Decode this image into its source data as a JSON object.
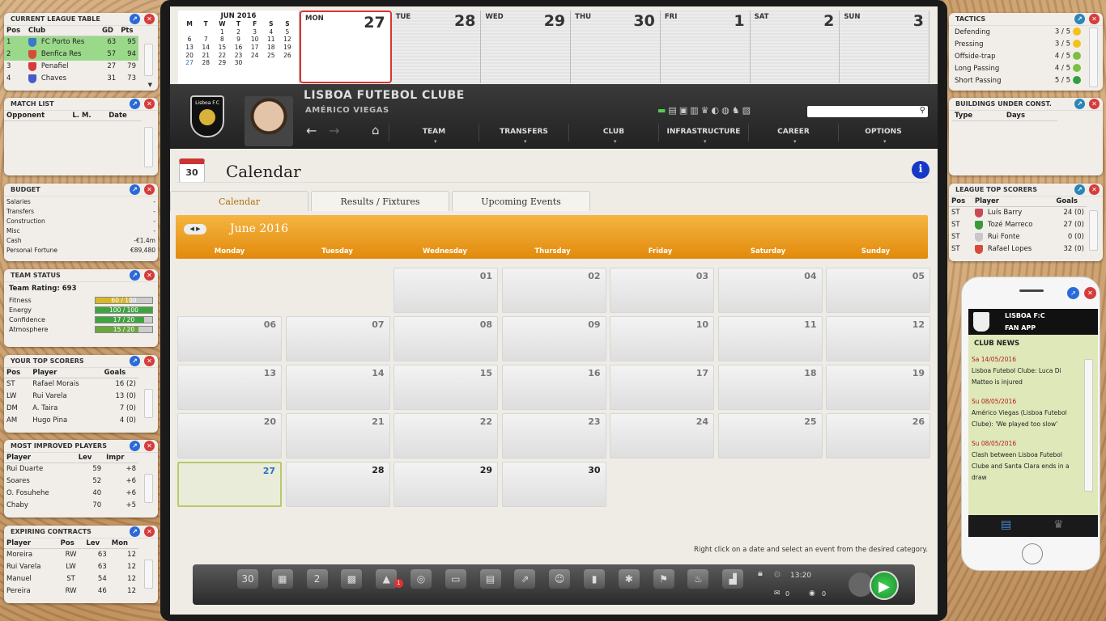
{
  "league_table": {
    "title": "CURRENT LEAGUE TABLE",
    "cols": [
      "Pos",
      "Club",
      "GD",
      "Pts"
    ],
    "rows": [
      [
        "1",
        "FC Porto Res",
        "63",
        "95"
      ],
      [
        "2",
        "Benfica Res",
        "57",
        "94"
      ],
      [
        "3",
        "Penafiel",
        "27",
        "79"
      ],
      [
        "4",
        "Chaves",
        "31",
        "73"
      ]
    ]
  },
  "match_list": {
    "title": "MATCH LIST",
    "cols": [
      "Opponent",
      "L. M.",
      "Date"
    ]
  },
  "budget": {
    "title": "BUDGET",
    "rows": [
      [
        "Salaries",
        "-"
      ],
      [
        "Transfers",
        "-"
      ],
      [
        "Construction",
        "-"
      ],
      [
        "Misc",
        "-"
      ],
      [
        "Cash",
        "-€1.4m"
      ],
      [
        "Personal Fortune",
        "€89,480"
      ]
    ]
  },
  "team_status": {
    "title": "TEAM STATUS",
    "rating": "Team Rating: 693",
    "rows": [
      {
        "label": "Fitness",
        "value": "60 / 100",
        "pct": 60,
        "color": "#d8b628"
      },
      {
        "label": "Energy",
        "value": "100 / 100",
        "pct": 100,
        "color": "#3ea53e"
      },
      {
        "label": "Confidence",
        "value": "17 / 20",
        "pct": 85,
        "color": "#3ea53e"
      },
      {
        "label": "Atmosphere",
        "value": "15 / 20",
        "pct": 75,
        "color": "#6aa83e"
      }
    ]
  },
  "your_scorers": {
    "title": "YOUR TOP SCORERS",
    "cols": [
      "Pos",
      "Player",
      "Goals"
    ],
    "rows": [
      [
        "ST",
        "Rafael Morais",
        "16 (2)"
      ],
      [
        "LW",
        "Rui Varela",
        "13 (0)"
      ],
      [
        "DM",
        "A. Taira",
        "7 (0)"
      ],
      [
        "AM",
        "Hugo Pina",
        "4 (0)"
      ]
    ]
  },
  "improved": {
    "title": "MOST IMPROVED PLAYERS",
    "cols": [
      "Player",
      "Lev",
      "Impr"
    ],
    "rows": [
      [
        "Rui Duarte",
        "59",
        "+8"
      ],
      [
        "Soares",
        "52",
        "+6"
      ],
      [
        "O. Fosuhehe",
        "40",
        "+6"
      ],
      [
        "Chaby",
        "70",
        "+5"
      ]
    ]
  },
  "contracts": {
    "title": "EXPIRING CONTRACTS",
    "cols": [
      "Player",
      "Pos",
      "Lev",
      "Mon"
    ],
    "rows": [
      [
        "Moreira",
        "RW",
        "63",
        "12"
      ],
      [
        "Rui Varela",
        "LW",
        "63",
        "12"
      ],
      [
        "Manuel",
        "ST",
        "54",
        "12"
      ],
      [
        "Pereira",
        "RW",
        "46",
        "12"
      ]
    ]
  },
  "mini_cal": {
    "month": "JUN 2016",
    "head": [
      "M",
      "T",
      "W",
      "T",
      "F",
      "S",
      "S"
    ],
    "weeks": [
      [
        "",
        "",
        "1",
        "2",
        "3",
        "4",
        "5"
      ],
      [
        "6",
        "7",
        "8",
        "9",
        "10",
        "11",
        "12"
      ],
      [
        "13",
        "14",
        "15",
        "16",
        "17",
        "18",
        "19"
      ],
      [
        "20",
        "21",
        "22",
        "23",
        "24",
        "25",
        "26"
      ],
      [
        "27",
        "28",
        "29",
        "30",
        "",
        "",
        ""
      ]
    ]
  },
  "week_strip": [
    [
      "MON",
      "27"
    ],
    [
      "TUE",
      "28"
    ],
    [
      "WED",
      "29"
    ],
    [
      "THU",
      "30"
    ],
    [
      "FRI",
      "1"
    ],
    [
      "SAT",
      "2"
    ],
    [
      "SUN",
      "3"
    ]
  ],
  "club": {
    "name": "LISBOA FUTEBOL CLUBE",
    "manager": "AMÉRICO VIEGAS",
    "badge": "Lisboa F.C"
  },
  "nav": [
    "TEAM",
    "TRANSFERS",
    "CLUB",
    "INFRASTRUCTURE",
    "CAREER",
    "OPTIONS"
  ],
  "page": {
    "title": "Calendar",
    "icon_day": "30"
  },
  "tabs": [
    "Calendar",
    "Results / Fixtures",
    "Upcoming Events"
  ],
  "calendar": {
    "month": "June 2016",
    "weekdays": [
      "Monday",
      "Tuesday",
      "Wednesday",
      "Thursday",
      "Friday",
      "Saturday",
      "Sunday"
    ],
    "days": [
      "01",
      "02",
      "03",
      "04",
      "05",
      "06",
      "07",
      "08",
      "09",
      "10",
      "11",
      "12",
      "13",
      "14",
      "15",
      "16",
      "17",
      "18",
      "19",
      "20",
      "21",
      "22",
      "23",
      "24",
      "25",
      "26",
      "27",
      "28",
      "29",
      "30"
    ],
    "today": "27"
  },
  "hint": "Right click on a date and select an event from the desired category.",
  "dock": {
    "time": "13:20",
    "mail": "0",
    "msg": "0",
    "badge": "1",
    "cal_day": "30"
  },
  "tactics": {
    "title": "TACTICS",
    "rows": [
      [
        "Defending",
        "3 / 5",
        "#f2c21c"
      ],
      [
        "Pressing",
        "3 / 5",
        "#f2c21c"
      ],
      [
        "Offside-trap",
        "4 / 5",
        "#7bc043"
      ],
      [
        "Long Passing",
        "4 / 5",
        "#7bc043"
      ],
      [
        "Short Passing",
        "5 / 5",
        "#2ea043"
      ]
    ]
  },
  "buildings": {
    "title": "BUILDINGS UNDER CONST.",
    "cols": [
      "Type",
      "Days"
    ]
  },
  "league_scorers": {
    "title": "LEAGUE TOP SCORERS",
    "cols": [
      "Pos",
      "Player",
      "Goals"
    ],
    "rows": [
      [
        "ST",
        "Luís Barry",
        "24 (0)"
      ],
      [
        "ST",
        "Tozé Marreco",
        "27 (0)"
      ],
      [
        "ST",
        "Rui Fonte",
        "0 (0)"
      ],
      [
        "ST",
        "Rafael Lopes",
        "32 (0)"
      ]
    ]
  },
  "fan_app": {
    "club": "LISBOA F:C",
    "app": "FAN APP",
    "section": "CLUB NEWS",
    "news": [
      {
        "date": "Sa 14/05/2016",
        "text": "Lisboa Futebol Clube: Luca Di Matteo is injured"
      },
      {
        "date": "Su 08/05/2016",
        "text": "Américo Viegas (Lisboa Futebol Clube): 'We played too slow'"
      },
      {
        "date": "Su 08/05/2016",
        "text": "Clash between Lisboa Futebol Clube and Santa Clara ends in a draw"
      }
    ]
  }
}
